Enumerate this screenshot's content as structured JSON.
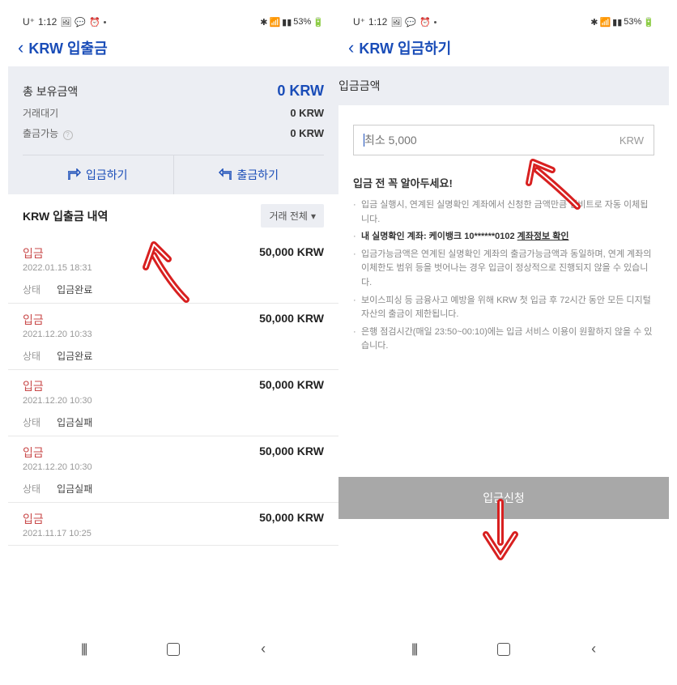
{
  "statusbar": {
    "carrier": "U⁺",
    "time": "1:12",
    "battery": "53%"
  },
  "left": {
    "title": "KRW 입출금",
    "summary": {
      "total_label": "총 보유금액",
      "total_value": "0 KRW",
      "pending_label": "거래대기",
      "pending_value": "0 KRW",
      "available_label": "출금가능",
      "available_value": "0 KRW"
    },
    "actions": {
      "deposit": "입금하기",
      "withdraw": "출금하기"
    },
    "history": {
      "title": "KRW 입출금 내역",
      "filter": "거래 전체",
      "status_label": "상태",
      "items": [
        {
          "type": "입금",
          "date": "2022.01.15 18:31",
          "amount": "50,000 KRW",
          "status": "입금완료"
        },
        {
          "type": "입금",
          "date": "2021.12.20 10:33",
          "amount": "50,000 KRW",
          "status": "입금완료"
        },
        {
          "type": "입금",
          "date": "2021.12.20 10:30",
          "amount": "50,000 KRW",
          "status": "입금실패"
        },
        {
          "type": "입금",
          "date": "2021.12.20 10:30",
          "amount": "50,000 KRW",
          "status": "입금실패"
        },
        {
          "type": "입금",
          "date": "2021.11.17 10:25",
          "amount": "50,000 KRW",
          "status": ""
        }
      ]
    }
  },
  "right": {
    "title": "KRW 입금하기",
    "amount_label": "입금금액",
    "placeholder": "최소 5,000",
    "unit": "KRW",
    "notice_title": "입금 전 꼭 알아두세요!",
    "notices": {
      "n1": "입금 실행시, 연계된 실명확인 계좌에서 신청한 금액만큼 업비트로 자동 이체됩니다.",
      "n2a": "내 실명확인 계좌: 케이뱅크 10******0102",
      "n2b": "계좌정보 확인",
      "n3": "입금가능금액은 연계된 실명확인 계좌의 출금가능금액과 동일하며, 연계 계좌의 이체한도 범위 등을 벗어나는 경우 입금이 정상적으로 진행되지 않을 수 있습니다.",
      "n4": "보이스피싱 등 금융사고 예방을 위해 KRW 첫 입금 후 72시간 동안 모든 디지털 자산의 출금이 제한됩니다.",
      "n5": "은행 점검시간(매일 23:50~00:10)에는 입금 서비스 이용이 원활하지 않을 수 있습니다."
    },
    "submit": "입금신청"
  }
}
